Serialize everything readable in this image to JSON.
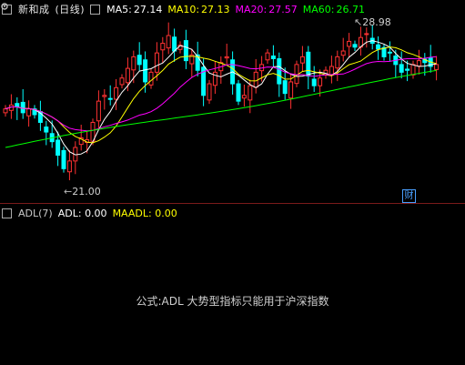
{
  "stock": {
    "name": "新和成",
    "period": "(日线)"
  },
  "ma": [
    {
      "label": "MA5:",
      "value": "27.14",
      "color": "#ffffff"
    },
    {
      "label": "MA10:",
      "value": "27.13",
      "color": "#ffff00"
    },
    {
      "label": "MA20:",
      "value": "27.57",
      "color": "#ff00ff"
    },
    {
      "label": "MA60:",
      "value": "26.71",
      "color": "#00ff00"
    }
  ],
  "annotations": {
    "high": "28.98",
    "low": "21.00",
    "cai": "财"
  },
  "indicator": {
    "name": "ADL(7)",
    "adl_label": "ADL:",
    "adl_value": "0.00",
    "maadl_label": "MAADL:",
    "maadl_value": "0.00",
    "note": "公式:ADL 大势型指标只能用于沪深指数"
  },
  "colors": {
    "up": "#ff3232",
    "down": "#00ffff",
    "ma5": "#ffffff",
    "ma10": "#ffff00",
    "ma20": "#ff00ff",
    "ma60": "#00ff00",
    "divider": "#7a1a1a"
  },
  "icons": [
    "gear-icon"
  ]
}
